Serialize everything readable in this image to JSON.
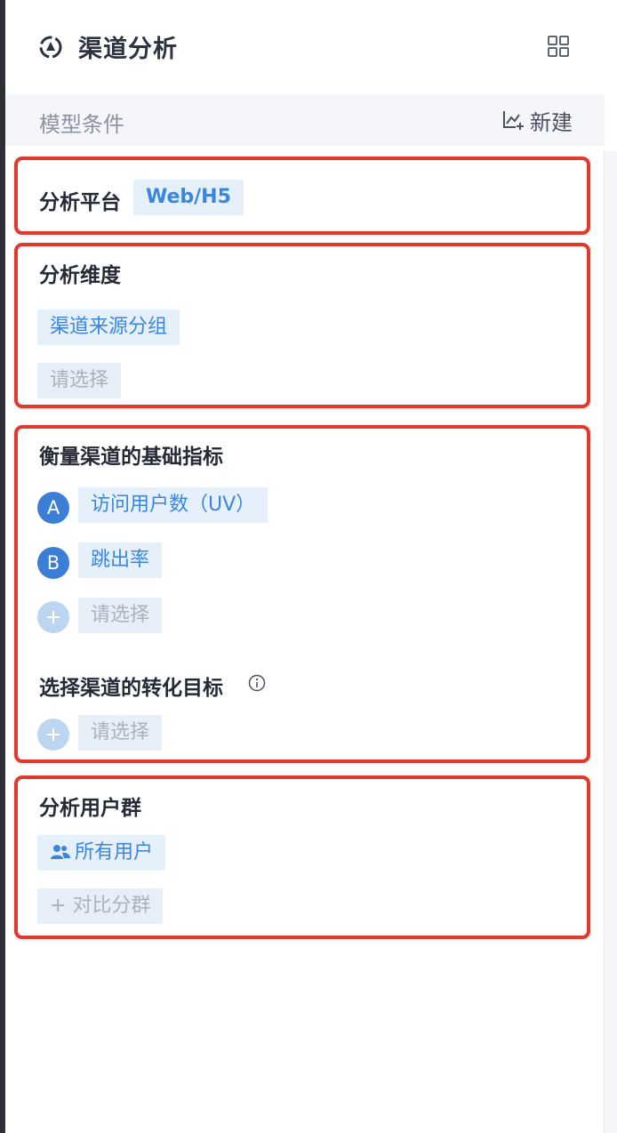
{
  "header": {
    "title": "渠道分析",
    "logo_icon": "chart-analysis-logo-icon",
    "grid_icon": "grid-view-icon"
  },
  "subbar": {
    "label": "模型条件",
    "new_label": "新建",
    "new_icon": "chart-add-icon"
  },
  "platform": {
    "title": "分析平台",
    "value": "Web/H5"
  },
  "dimension": {
    "title": "分析维度",
    "selected": "渠道来源分组",
    "placeholder": "请选择"
  },
  "metrics": {
    "title": "衡量渠道的基础指标",
    "items": [
      {
        "badge": "A",
        "label": "访问用户数（UV）"
      },
      {
        "badge": "B",
        "label": "跳出率"
      }
    ],
    "placeholder": "请选择"
  },
  "goal": {
    "title": "选择渠道的转化目标",
    "placeholder": "请选择",
    "info_icon": "info-icon"
  },
  "user_group": {
    "title": "分析用户群",
    "selected": "所有用户",
    "compare_label": "对比分群",
    "compare_prefix": "+"
  },
  "colors": {
    "accent": "#3a7fd5",
    "tag_bg": "#e6f0fb",
    "highlight_border": "#e03a2e"
  }
}
